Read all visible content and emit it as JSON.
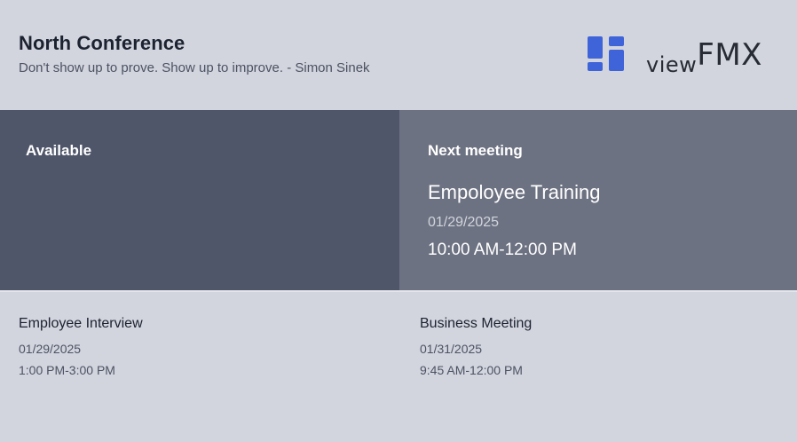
{
  "header": {
    "room_name": "North Conference",
    "quote": "Don't show up to prove. Show up to improve. - Simon Sinek"
  },
  "logo": {
    "icon": "dashboard-grid-icon",
    "text_prefix": "view",
    "text_suffix": "FMX",
    "color": "#3f63d8"
  },
  "status": {
    "label": "Available",
    "color": "#50566a"
  },
  "next_meeting": {
    "label": "Next meeting",
    "title": "Empoloyee Training",
    "date": "01/29/2025",
    "time": "10:00 AM-12:00 PM"
  },
  "upcoming": [
    {
      "title": "Employee Interview",
      "date": "01/29/2025",
      "time": "1:00 PM-3:00 PM"
    },
    {
      "title": "Business Meeting",
      "date": "01/31/2025",
      "time": "9:45 AM-12:00 PM"
    }
  ]
}
